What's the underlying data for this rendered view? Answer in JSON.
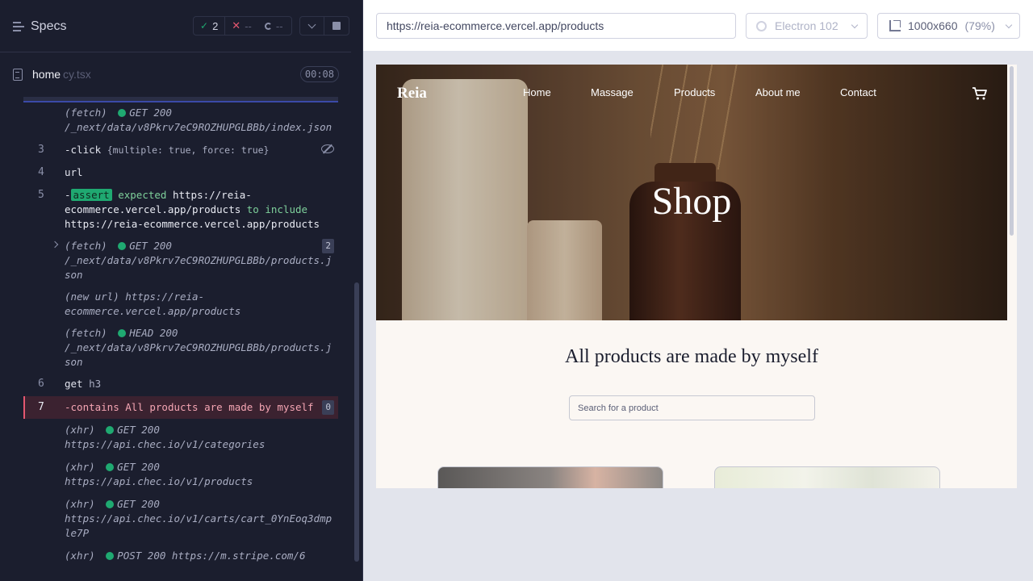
{
  "reporter": {
    "specs_label": "Specs",
    "stats": {
      "passed": "2",
      "failed": "--",
      "pending": "--"
    },
    "file": {
      "name": "home",
      "ext": "cy.tsx",
      "duration": "00:08"
    },
    "commands": [
      {
        "num": "",
        "event": "(fetch)",
        "method": "GET 200",
        "url": "/_next/data/v8Pkrv7eC9ROZHUPGLBBb/index.json"
      },
      {
        "num": "3",
        "name": "-click",
        "message": "{multiple: true, force: true}"
      },
      {
        "num": "4",
        "name": "url"
      },
      {
        "num": "5",
        "name": "-",
        "badge": "assert",
        "parts": [
          "expected",
          "https://reia-ecommerce.vercel.app/products",
          "to include",
          "https://reia-ecommerce.vercel.app/products"
        ]
      },
      {
        "num": "",
        "event": "(fetch)",
        "method": "GET 200",
        "url": "/_next/data/v8Pkrv7eC9ROZHUPGLBBb/products.json",
        "count": "2"
      },
      {
        "num": "",
        "event": "(new url)",
        "url": "https://reia-ecommerce.vercel.app/products"
      },
      {
        "num": "",
        "event": "(fetch)",
        "method": "HEAD 200",
        "url": "/_next/data/v8Pkrv7eC9ROZHUPGLBBb/products.json"
      },
      {
        "num": "6",
        "name": "get",
        "message": "h3"
      },
      {
        "num": "7",
        "name": "-contains",
        "message": "All products are made by myself",
        "count": "0"
      },
      {
        "num": "",
        "event": "(xhr)",
        "method": "GET 200",
        "url": "https://api.chec.io/v1/categories"
      },
      {
        "num": "",
        "event": "(xhr)",
        "method": "GET 200",
        "url": "https://api.chec.io/v1/products"
      },
      {
        "num": "",
        "event": "(xhr)",
        "method": "GET 200",
        "url": "https://api.chec.io/v1/carts/cart_0YnEoq3dmple7P"
      },
      {
        "num": "",
        "event": "(xhr)",
        "method": "POST 200",
        "url": "https://m.stripe.com/6"
      }
    ]
  },
  "preview": {
    "url": "https://reia-ecommerce.vercel.app/products",
    "browser": "Electron 102",
    "viewport": "1000x660",
    "zoom": "(79%)"
  },
  "site": {
    "logo": "Reia",
    "nav": [
      "Home",
      "Massage",
      "Products",
      "About me",
      "Contact"
    ],
    "hero_title": "Shop",
    "heading": "All products are made by myself",
    "search_placeholder": "Search for a product"
  },
  "colors": {
    "pass": "#1fa971",
    "fail": "#e45770",
    "accent": "#3b4aa8"
  }
}
